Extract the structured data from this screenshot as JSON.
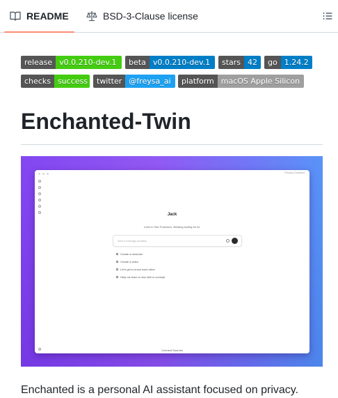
{
  "tabs": {
    "readme_label": "README",
    "license_label": "BSD-3-Clause license"
  },
  "badges": [
    {
      "label": "release",
      "value": "v0.0.210-dev.1",
      "color": "#4c1"
    },
    {
      "label": "beta",
      "value": "v0.0.210-dev.1",
      "color": "#007ec6"
    },
    {
      "label": "stars",
      "value": "42",
      "color": "#007ec6"
    },
    {
      "label": "go",
      "value": "1.24.2",
      "color": "#007ec6"
    },
    {
      "label": "checks",
      "value": "success",
      "color": "#4c1"
    },
    {
      "label": "twitter",
      "value": "@freysa_ai",
      "color": "#1da1f2"
    },
    {
      "label": "platform",
      "value": "macOS Apple Silicon",
      "color": "#9f9f9f"
    }
  ],
  "title": "Enchanted-Twin",
  "screenshot": {
    "privacy_label": "Privacy Enabled",
    "name": "Jack",
    "bio": "Lives in San Francisco. Building tooling for AI.",
    "input_placeholder": "Send a message privately...",
    "suggestions": [
      "Create a reminder",
      "Create a video",
      "Let's get to know each other",
      "Help me learn a new skill or concept"
    ],
    "connect_sources": "Connect Sources"
  },
  "description": "Enchanted is a personal AI assistant focused on privacy."
}
